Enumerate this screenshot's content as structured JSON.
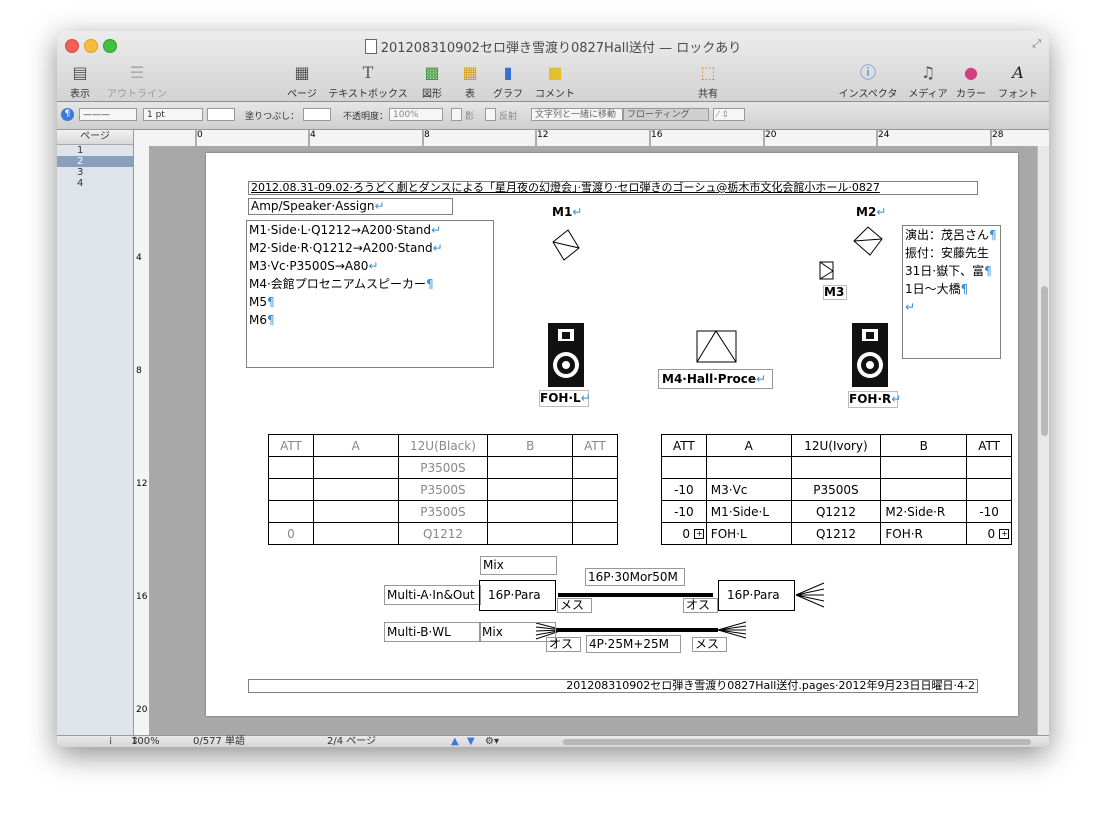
{
  "window": {
    "title": "201208310902セロ弾き雪渡り0827Hall送付 — ロックあり"
  },
  "toolbar": {
    "view": "表示",
    "outline": "アウトライン",
    "page": "ページ",
    "textbox": "テキストボックス",
    "shapes": "図形",
    "table": "表",
    "chart": "グラフ",
    "comment": "コメント",
    "share": "共有",
    "inspector": "インスペクタ",
    "media": "メディア",
    "colors": "カラー",
    "fonts": "フォント"
  },
  "formatbar": {
    "stroke_width": "1 pt",
    "fill_label": "塗りつぶし：",
    "opacity_label": "不透明度：",
    "opacity_value": "100%",
    "shadow_label": "影",
    "reflection_label": "反射",
    "move_with_text": "文字列と一緒に移動",
    "floating": "フローティング"
  },
  "sidebar": {
    "header": "ページ",
    "pages": [
      "1",
      "2",
      "3",
      "4"
    ]
  },
  "ruler": {
    "top": [
      "0",
      "4",
      "8",
      "12",
      "16",
      "20",
      "24",
      "28"
    ],
    "left": [
      "4",
      "8",
      "12",
      "16",
      "20"
    ]
  },
  "doc": {
    "header_line": "2012.08.31-09.02·ろうどく劇とダンスによる「星月夜の幻燈会」·雪渡り·セロ弾きのゴーシュ@栃木市文化会館小ホール·0827",
    "amp_title": "Amp/Speaker·Assign",
    "assign_lines": [
      "M1·Side·L·Q1212→A200·Stand",
      "M2·Side·R·Q1212→A200·Stand",
      "M3·Vc·P3500S→A80",
      "M4·会館プロセニアムスピーカー",
      "M5",
      "M6"
    ],
    "notes": [
      "演出：茂呂さん",
      "振付：安藤先生",
      "31日·嶽下、富",
      "1日〜大橋"
    ],
    "labels": {
      "m1": "M1",
      "m2": "M2",
      "m3": "M3",
      "m4": "M4·Hall·Proce",
      "foh_l": "FOH·L",
      "foh_r": "FOH·R"
    },
    "left_table": {
      "headers": [
        "ATT",
        "A",
        "12U(Black)",
        "B",
        "ATT"
      ],
      "rows": [
        [
          "",
          "",
          "P3500S",
          "",
          ""
        ],
        [
          "",
          "",
          "P3500S",
          "",
          ""
        ],
        [
          "",
          "",
          "P3500S",
          "",
          ""
        ],
        [
          "0",
          "",
          "Q1212",
          "",
          ""
        ]
      ]
    },
    "right_table": {
      "headers": [
        "ATT",
        "A",
        "12U(Ivory)",
        "B",
        "ATT"
      ],
      "rows": [
        [
          "",
          "",
          "",
          "",
          ""
        ],
        [
          "-10",
          "M3·Vc",
          "P3500S",
          "",
          ""
        ],
        [
          "-10",
          "M1·Side·L",
          "Q1212",
          "M2·Side·R",
          "-10"
        ],
        [
          "0",
          "FOH·L",
          "Q1212",
          "FOH·R",
          "0"
        ]
      ]
    },
    "wiring": {
      "mix_top": "Mix",
      "multi_a": "Multi-A·In&Out",
      "para_left": "16P·Para",
      "cable_top": "16P·30Mor50M",
      "para_right": "16P·Para",
      "mesu1": "メス",
      "osu1": "オス",
      "multi_b": "Multi-B·WL",
      "mix_bottom": "Mix",
      "osu2": "オス",
      "cable_bottom": "4P·25M+25M",
      "mesu2": "メス"
    },
    "footer": "201208310902セロ弾き雪渡り0827Hall送付.pages·2012年9月23日日曜日·4-2"
  },
  "status": {
    "zoom": "100%",
    "words": "0/577 単語",
    "page": "2/4 ページ"
  }
}
